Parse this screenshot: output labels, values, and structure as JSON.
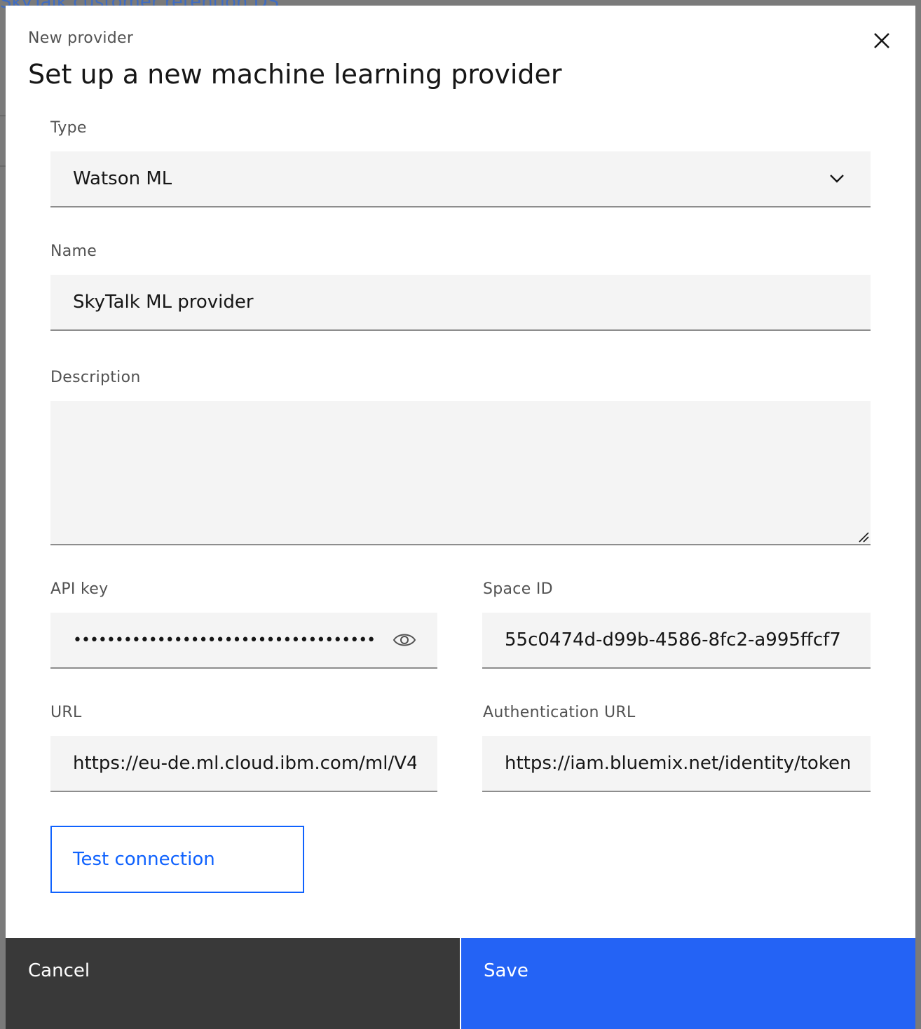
{
  "background": {
    "link_text": "SkyTalk customer retention DS"
  },
  "modal": {
    "label": "New provider",
    "heading": "Set up a new machine learning provider",
    "close_icon": "close-icon"
  },
  "form": {
    "type": {
      "label": "Type",
      "selected": "Watson ML"
    },
    "name": {
      "label": "Name",
      "value": "SkyTalk ML provider"
    },
    "description": {
      "label": "Description",
      "value": ""
    },
    "api_key": {
      "label": "API key",
      "masked_value": "••••••••••••••••••••••••••••••••••••••••••"
    },
    "space_id": {
      "label": "Space ID",
      "value": "55c0474d-d99b-4586-8fc2-a995ffcf7"
    },
    "url": {
      "label": "URL",
      "value": "https://eu-de.ml.cloud.ibm.com/ml/V4"
    },
    "auth_url": {
      "label": "Authentication URL",
      "value": "https://iam.bluemix.net/identity/token"
    },
    "test_button": "Test connection"
  },
  "footer": {
    "cancel_label": "Cancel",
    "save_label": "Save"
  },
  "colors": {
    "primary": "#0f62fe",
    "save_bg": "#2463f5",
    "cancel_bg": "#393939",
    "field_bg": "#f4f4f4"
  }
}
